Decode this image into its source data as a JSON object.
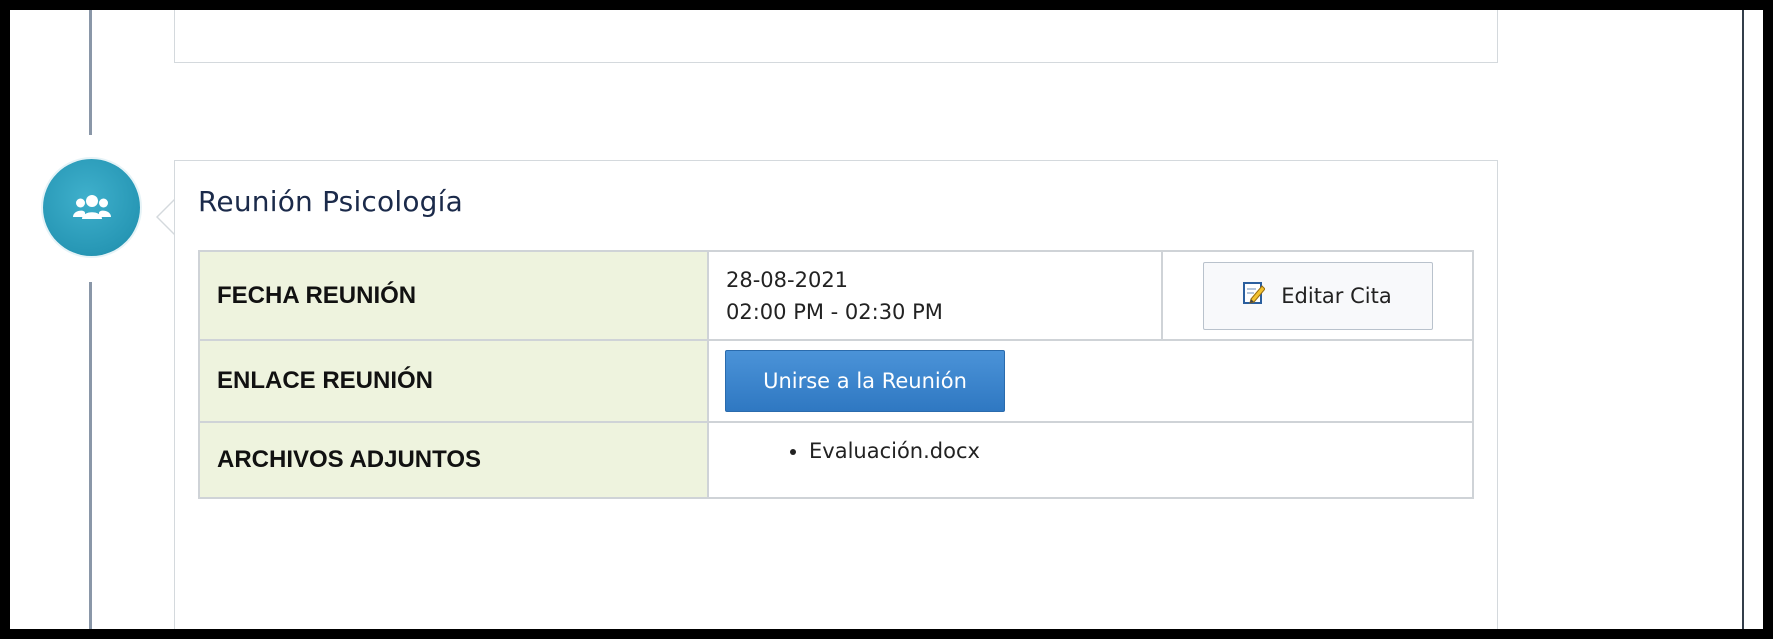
{
  "meeting": {
    "title": "Reunión Psicología",
    "icon": "group-users-icon",
    "rows": {
      "date": {
        "label": "FECHA REUNIÓN",
        "date": "28-08-2021",
        "time": "02:00 PM - 02:30 PM"
      },
      "link": {
        "label": "ENLACE REUNIÓN"
      },
      "files": {
        "label": "ARCHIVOS ADJUNTOS",
        "items": [
          "Evaluación.docx"
        ]
      }
    },
    "buttons": {
      "edit": {
        "label": "Editar Cita",
        "icon": "edit-note-icon"
      },
      "join": {
        "label": "Unirse a la Reunión"
      }
    }
  },
  "colors": {
    "badge": "#2797b5",
    "label_cell_bg": "#eef3de",
    "join_button": "#3a84cc",
    "title_text": "#1b2a4a"
  }
}
